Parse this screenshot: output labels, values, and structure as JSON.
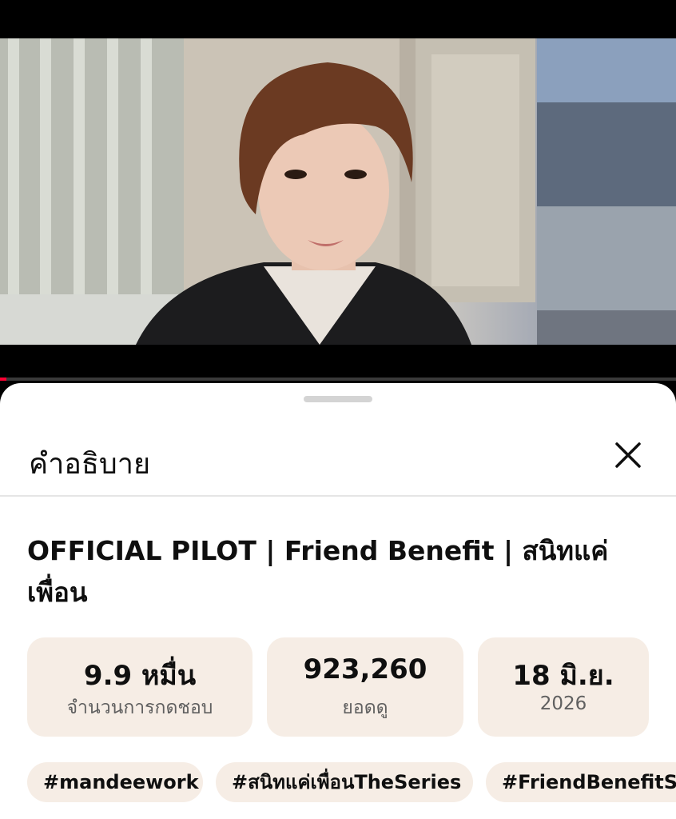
{
  "player": {
    "progress_fraction": 0.01
  },
  "sheet": {
    "title": "คำอธิบาย",
    "close_icon": "close-icon"
  },
  "video": {
    "title": "OFFICIAL PILOT | Friend Benefit | สนิทแค่เพื่อน"
  },
  "stats": [
    {
      "value": "9.9 หมื่น",
      "label": "จำนวนการกดชอบ"
    },
    {
      "value": "923,260",
      "label": "ยอดดู"
    },
    {
      "value": "18 มิ.ย.",
      "label": "2026"
    }
  ],
  "hashtags": [
    "#mandeework",
    "#สนิทแค่เพื่อนTheSeries",
    "#FriendBenefitSe"
  ],
  "colors": {
    "accent_red": "#ff0033",
    "chip_bg": "#f6ede5",
    "text_primary": "#0f0f0f",
    "text_secondary": "#606060"
  }
}
